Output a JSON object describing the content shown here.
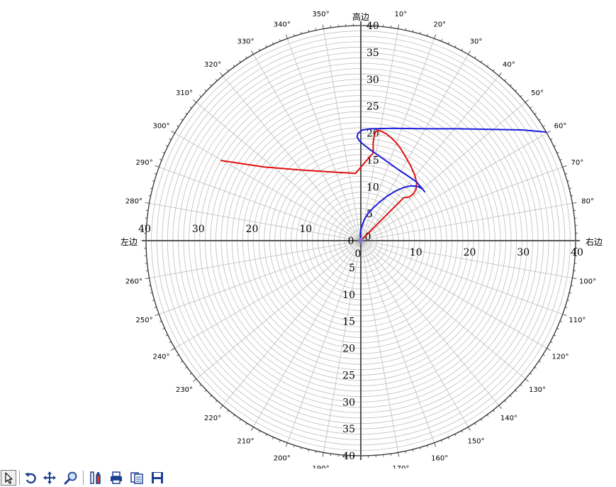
{
  "chart_data": {
    "type": "polar",
    "r_max": 40,
    "ring_step": 1,
    "spoke_step_deg": 10,
    "angle_zero": "top",
    "angle_direction": "clockwise",
    "axis_titles": {
      "top": "高边",
      "right": "右边",
      "left": "左边",
      "bottom": ""
    },
    "top_axis_ticks": [
      "5",
      "10",
      "15",
      "20",
      "25",
      "30",
      "35",
      "40"
    ],
    "bottom_axis_ticks": [
      "5",
      "10",
      "15",
      "20",
      "25",
      "30",
      "35",
      "40"
    ],
    "right_axis_ticks": [
      "0",
      "10",
      "20",
      "30",
      "40"
    ],
    "left_axis_ticks": [
      "0",
      "10",
      "20",
      "30",
      "40"
    ],
    "origin_label": "0",
    "angle_labels": [
      "10°",
      "20°",
      "30°",
      "40°",
      "50°",
      "60°",
      "70°",
      "80°",
      "100°",
      "110°",
      "120°",
      "130°",
      "140°",
      "150°",
      "160°",
      "170°",
      "190°",
      "200°",
      "210°",
      "220°",
      "230°",
      "240°",
      "250°",
      "260°",
      "280°",
      "290°",
      "300°",
      "310°",
      "320°",
      "330°",
      "340°",
      "350°"
    ],
    "series": [
      {
        "color": "#e01010",
        "x": [
          0,
          0.5,
          1.0,
          1.6,
          2.4,
          3.3,
          4.4,
          5.6,
          6.8,
          8.0,
          9.0,
          9.8,
          10.3,
          10.4,
          10.0,
          9.3,
          8.4,
          7.5,
          6.6,
          5.6,
          4.7,
          3.9,
          3.3,
          2.8,
          2.5,
          2.3,
          2.3,
          -1.0,
          -6.0,
          -12.0,
          -18.0,
          -26.0
        ],
        "y": [
          0,
          0.5,
          1.0,
          1.6,
          2.4,
          3.3,
          4.4,
          5.6,
          6.8,
          8.0,
          8.1,
          8.7,
          9.6,
          10.8,
          12.3,
          13.9,
          15.5,
          17.0,
          18.2,
          19.2,
          19.9,
          20.3,
          20.5,
          20.3,
          19.6,
          18.2,
          16.3,
          12.5,
          12.8,
          13.2,
          13.7,
          14.9
        ]
      },
      {
        "color": "#1a1adc",
        "x": [
          0,
          -0.1,
          0,
          0.3,
          0.7,
          1.3,
          2.2,
          3.4,
          4.8,
          6.4,
          8.0,
          9.4,
          10.6,
          11.5,
          11.9,
          11.5,
          10.4,
          8.8,
          7.0,
          5.2,
          3.5,
          1.9,
          0.6,
          -0.3,
          -0.7,
          -0.5,
          0.3,
          2.0,
          6.0,
          12.0,
          18.0,
          24.0,
          30.0,
          34.5
        ],
        "y": [
          0,
          1.0,
          2.0,
          3.0,
          4.0,
          5.0,
          6.0,
          7.1,
          8.2,
          9.2,
          9.9,
          10.2,
          10.1,
          9.6,
          9.1,
          9.6,
          10.9,
          12.0,
          13.2,
          14.5,
          15.7,
          16.8,
          17.8,
          18.6,
          19.3,
          20.0,
          20.6,
          20.8,
          20.9,
          20.8,
          20.8,
          20.7,
          20.6,
          20.2
        ]
      }
    ]
  },
  "toolbar": {
    "items": [
      {
        "name": "pointer-tool-button",
        "icon": "pointer-icon",
        "active": true
      },
      {
        "name": "rotate-tool-button",
        "icon": "rotate-icon",
        "active": false
      },
      {
        "name": "pan-tool-button",
        "icon": "pan-icon",
        "active": false
      },
      {
        "name": "zoom-tool-button",
        "icon": "zoom-icon",
        "active": false
      },
      {
        "name": "properties-button",
        "icon": "properties-icon",
        "active": false
      },
      {
        "name": "print-button",
        "icon": "print-icon",
        "active": false
      },
      {
        "name": "copy-button",
        "icon": "copy-icon",
        "active": false
      },
      {
        "name": "save-button",
        "icon": "save-icon",
        "active": false
      }
    ]
  }
}
